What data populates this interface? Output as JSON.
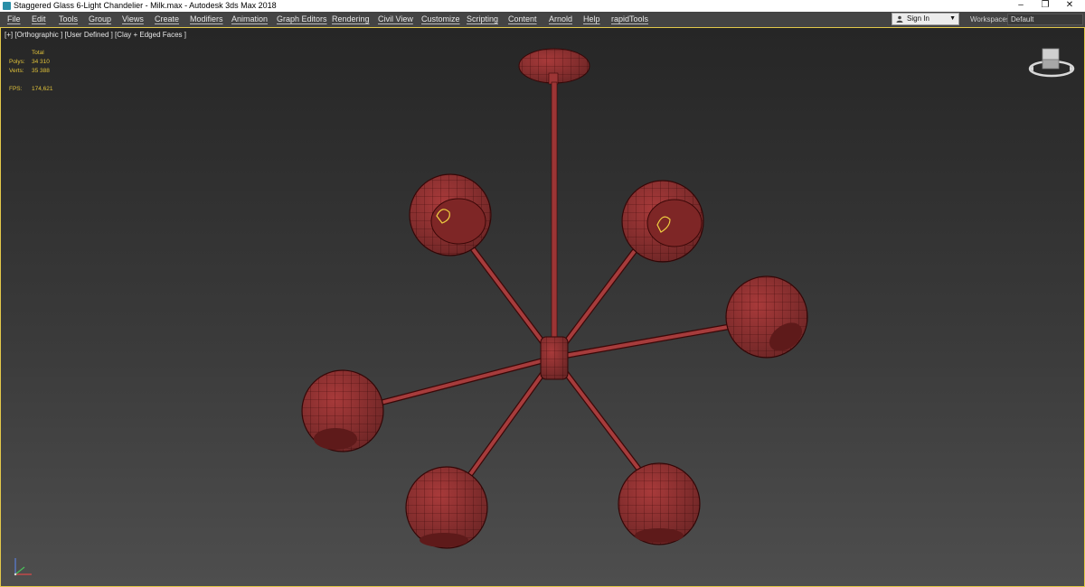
{
  "window": {
    "title": "Staggered Glass 6-Light Chandelier - Milk.max - Autodesk 3ds Max 2018",
    "controls": {
      "minimize": "–",
      "restore": "❐",
      "close": "✕"
    }
  },
  "menu": {
    "items": [
      {
        "label": "File"
      },
      {
        "label": "Edit"
      },
      {
        "label": "Tools"
      },
      {
        "label": "Group"
      },
      {
        "label": "Views"
      },
      {
        "label": "Create"
      },
      {
        "label": "Modifiers"
      },
      {
        "label": "Animation"
      },
      {
        "label": "Graph Editors"
      },
      {
        "label": "Rendering"
      },
      {
        "label": "Civil View"
      },
      {
        "label": "Customize"
      },
      {
        "label": "Scripting"
      },
      {
        "label": "Content"
      },
      {
        "label": "Arnold"
      },
      {
        "label": "Help"
      },
      {
        "label": "rapidTools"
      }
    ]
  },
  "account": {
    "sign_in": "Sign In",
    "icon": "user-icon"
  },
  "workspaces": {
    "label": "Workspaces:",
    "value": "Default"
  },
  "viewport": {
    "label": "[+] [Orthographic ] [User Defined ] [Clay + Edged Faces ]",
    "stats": {
      "header": "Total",
      "polys_label": "Polys:",
      "polys_value": "34 310",
      "verts_label": "Verts:",
      "verts_value": "35 388",
      "fps_label": "FPS:",
      "fps_value": "174,621"
    },
    "colors": {
      "model": "#a83a3a",
      "wire": "#5a1010",
      "stats": "#e0c23a",
      "border": "#e3c84a"
    }
  }
}
